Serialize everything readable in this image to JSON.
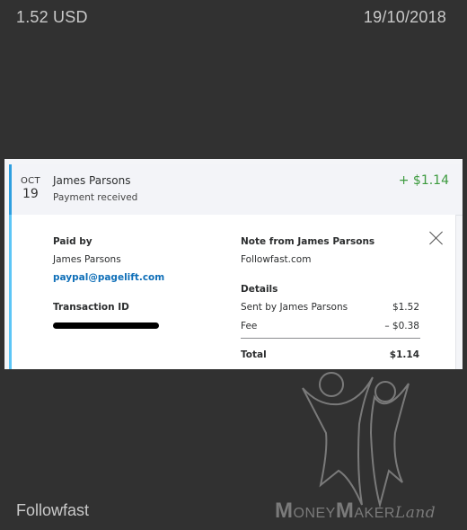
{
  "overlay": {
    "amount": "1.52 USD",
    "date": "19/10/2018",
    "source": "Followfast"
  },
  "transaction": {
    "month": "OCT",
    "day": "19",
    "name": "James Parsons",
    "status": "Payment received",
    "amount": "+ $1.14",
    "paid_by_label": "Paid by",
    "paid_by_name": "James Parsons",
    "paid_by_email": "paypal@pagelift.com",
    "transaction_id_label": "Transaction ID",
    "note_label": "Note from James Parsons",
    "note_text": "Followfast.com",
    "details_label": "Details",
    "details": [
      {
        "label": "Sent by James Parsons",
        "value": "$1.52"
      },
      {
        "label": "Fee",
        "value": "– $0.38"
      }
    ],
    "total_label": "Total",
    "total_value": "$1.14"
  },
  "watermark": {
    "part1_initial": "M",
    "part1_rest": "ONEY",
    "part2_initial": "M",
    "part2_rest": "AKER",
    "script": "Land"
  },
  "colors": {
    "background": "#313131",
    "accent": "#2e9fe0",
    "positive": "#3c9a3e",
    "link": "#0f6fb8"
  }
}
